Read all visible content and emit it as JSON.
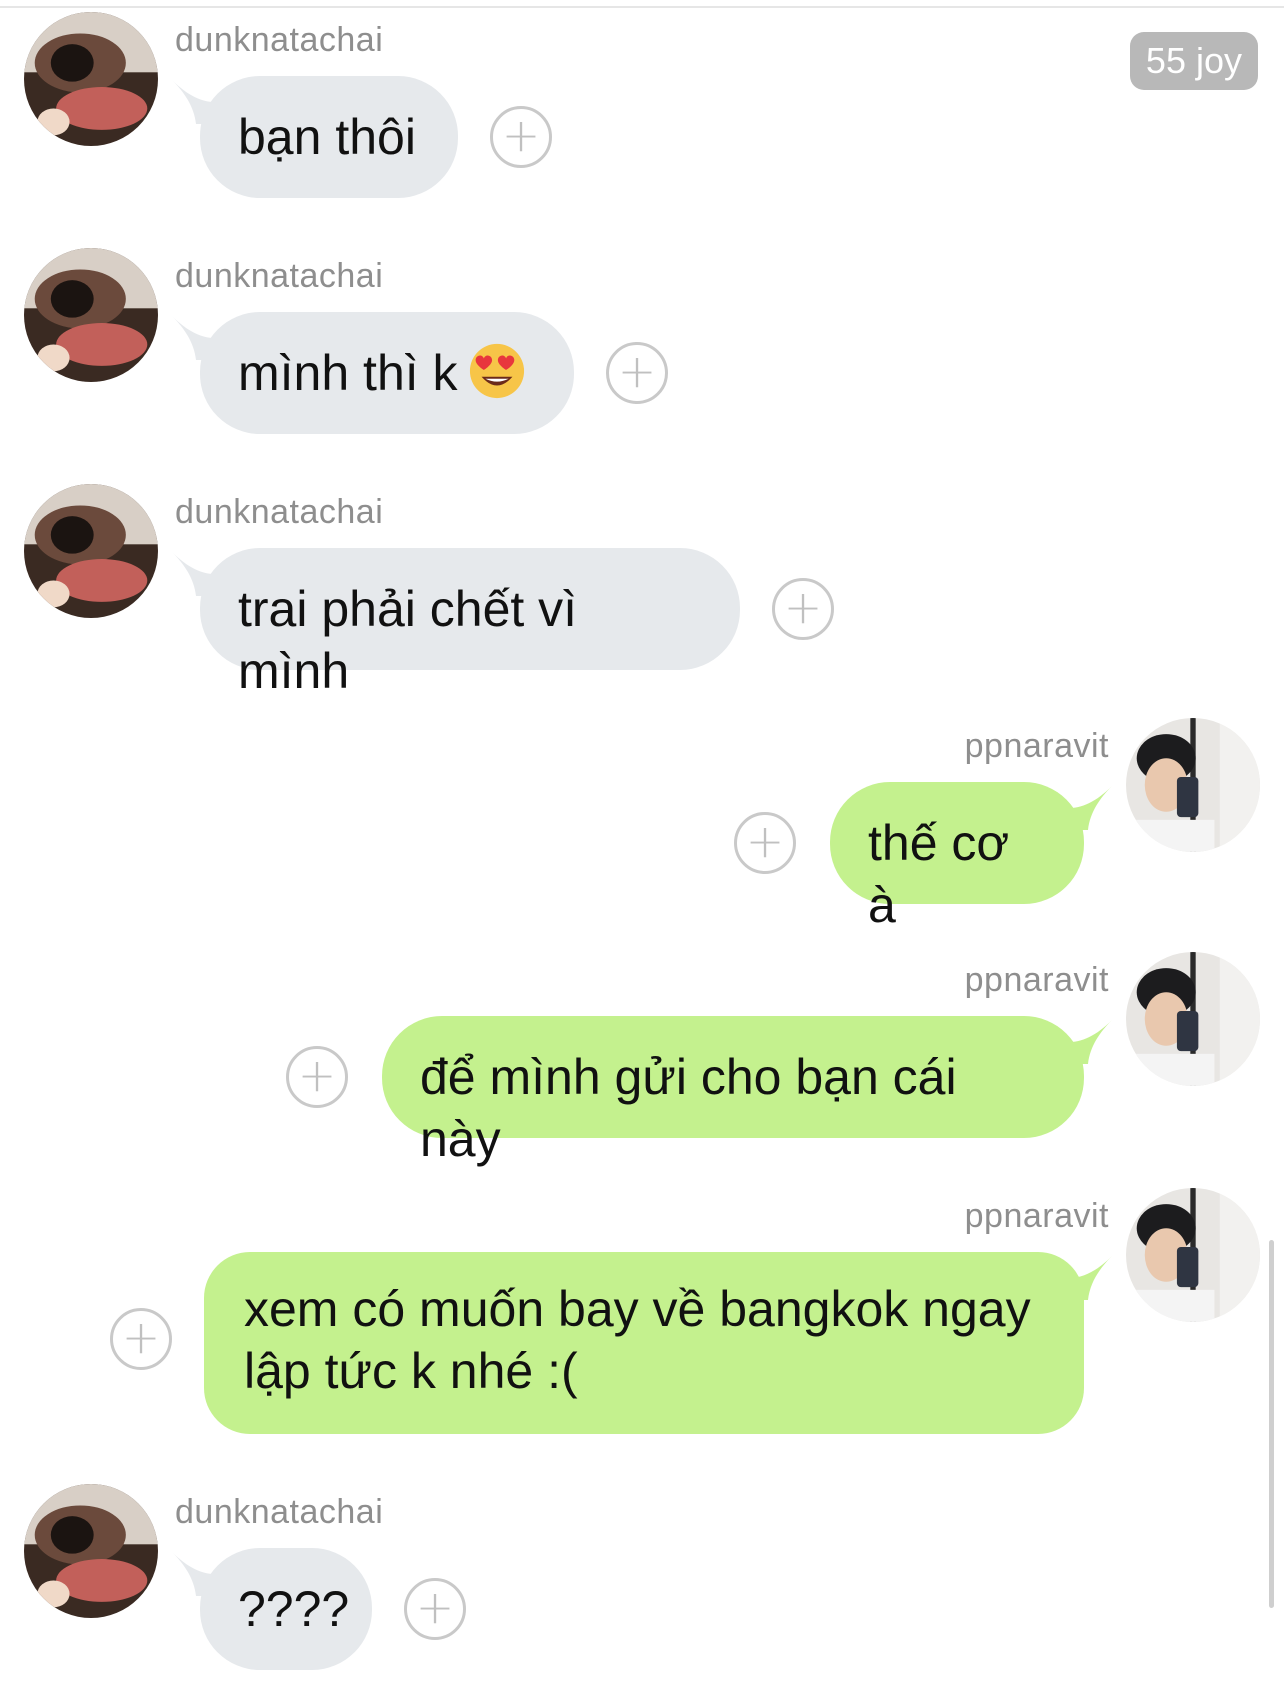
{
  "badge": {
    "label": "55 joy"
  },
  "messages": [
    {
      "sender": "dunknatachai",
      "text": "bạn thôi",
      "direction": "in"
    },
    {
      "sender": "dunknatachai",
      "text": "mình thì k",
      "emoji": "heart-eyes-emoji",
      "direction": "in"
    },
    {
      "sender": "dunknatachai",
      "text": "trai phải chết vì mình",
      "direction": "in"
    },
    {
      "sender": "ppnaravit",
      "text": "thế cơ à",
      "direction": "out"
    },
    {
      "sender": "ppnaravit",
      "text": "để mình gửi cho bạn cái này",
      "direction": "out"
    },
    {
      "sender": "ppnaravit",
      "lines": [
        "xem có muốn bay về bangkok ngay",
        "lập tức k nhé :("
      ],
      "direction": "out"
    },
    {
      "sender": "dunknatachai",
      "text": "????",
      "direction": "in"
    }
  ],
  "icons": {
    "add_reaction": "+",
    "add_reaction_name": "add-reaction-icon"
  },
  "colors": {
    "incoming_bubble": "#e6e9ec",
    "outgoing_bubble": "#c4f18e",
    "sender_text": "#8e8e8e",
    "badge_bg": "#b8b8b8"
  }
}
